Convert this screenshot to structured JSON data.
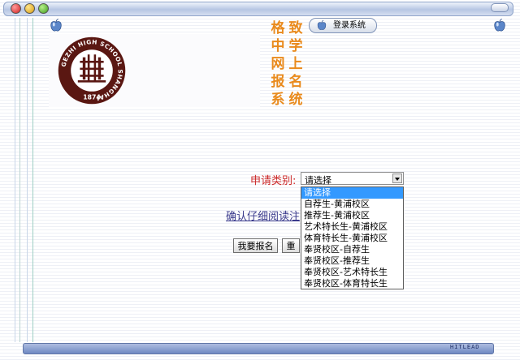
{
  "title_chars": [
    "格",
    "致",
    "中",
    "学",
    "网",
    "上",
    "报",
    "名",
    "系",
    "统"
  ],
  "login_label": "登录系统",
  "seal": {
    "ring_text": "GEZHI HIGH SCHOOL SHANGHAI",
    "year": "1874"
  },
  "form": {
    "type_label": "申请类别:",
    "select_value": "请选择",
    "options": [
      "请选择",
      "自荐生-黄浦校区",
      "推荐生-黄浦校区",
      "艺术特长生-黄浦校区",
      "体育特长生-黄浦校区",
      "奉贤校区-自荐生",
      "奉贤校区-推荐生",
      "奉贤校区-艺术特长生",
      "奉贤校区-体育特长生"
    ],
    "confirm_link": "确认仔细阅读注",
    "apply_button": "我要报名",
    "reset_button": "重"
  },
  "footer_text": "HITLEAD",
  "colors": {
    "title_orange": "#e98a1c",
    "label_red": "#cc2a2a",
    "highlight": "#3399ff"
  }
}
